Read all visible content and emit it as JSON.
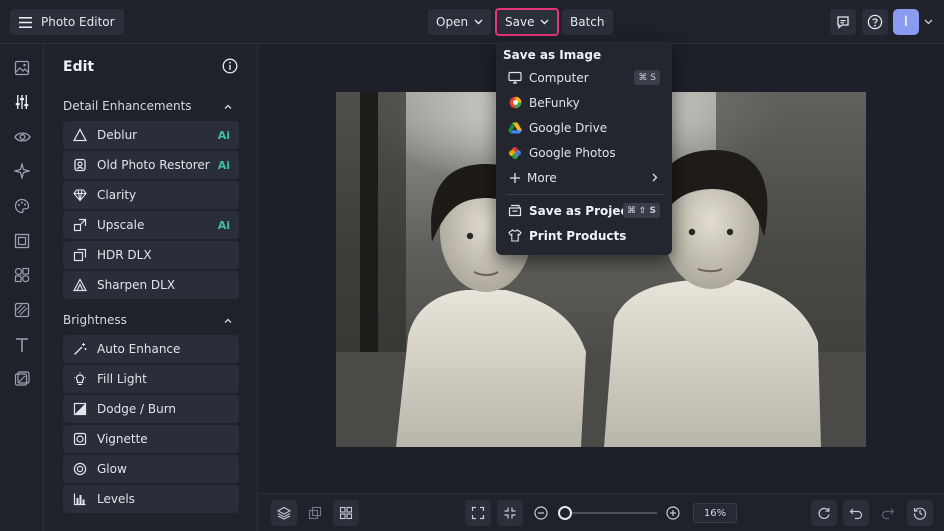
{
  "header": {
    "menu_icon": "hamburger-icon",
    "app_title": "Photo Editor",
    "open_label": "Open",
    "save_label": "Save",
    "batch_label": "Batch",
    "avatar_initial": "I",
    "save_highlight_color": "#e8357a"
  },
  "left_rail": {
    "items": [
      "image-icon",
      "sliders-icon",
      "eye-icon",
      "sparkle-icon",
      "palette-icon",
      "frame-icon",
      "shapes-icon",
      "texture-icon",
      "text-icon",
      "crop-icon"
    ]
  },
  "panel": {
    "title": "Edit",
    "sections": [
      {
        "label": "Detail Enhancements",
        "tools": [
          {
            "label": "Deblur",
            "ai": "Ai"
          },
          {
            "label": "Old Photo Restorer",
            "ai": "Ai"
          },
          {
            "label": "Clarity",
            "ai": ""
          },
          {
            "label": "Upscale",
            "ai": "Ai"
          },
          {
            "label": "HDR DLX",
            "ai": ""
          },
          {
            "label": "Sharpen DLX",
            "ai": ""
          }
        ]
      },
      {
        "label": "Brightness",
        "tools": [
          {
            "label": "Auto Enhance"
          },
          {
            "label": "Fill Light"
          },
          {
            "label": "Dodge / Burn"
          },
          {
            "label": "Vignette"
          },
          {
            "label": "Glow"
          },
          {
            "label": "Levels"
          }
        ]
      }
    ]
  },
  "save_menu": {
    "heading": "Save as Image",
    "items": [
      {
        "label": "Computer",
        "shortcut": "⌘ S"
      },
      {
        "label": "BeFunky"
      },
      {
        "label": "Google Drive"
      },
      {
        "label": "Google Photos"
      },
      {
        "label": "More"
      }
    ],
    "project_label": "Save as Project",
    "project_shortcut": "⌘ ⇧ S",
    "print_label": "Print Products"
  },
  "bottom": {
    "zoom": "16%"
  }
}
